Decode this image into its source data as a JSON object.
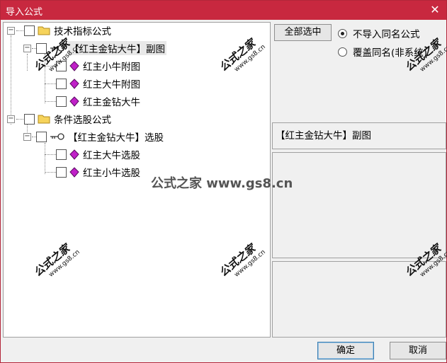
{
  "window": {
    "title": "导入公式"
  },
  "tree": {
    "groups": [
      {
        "label": "技术指标公式",
        "children": [
          {
            "label": "【红主金钻大牛】副图",
            "children": [
              {
                "label": "红主小牛附图"
              },
              {
                "label": "红主大牛附图"
              },
              {
                "label": "红主金钻大牛"
              }
            ]
          }
        ]
      },
      {
        "label": "条件选股公式",
        "children": [
          {
            "label": "【红主金钻大牛】选股",
            "children": [
              {
                "label": "红主大牛选股"
              },
              {
                "label": "红主小牛选股"
              }
            ]
          }
        ]
      }
    ]
  },
  "options": {
    "select_all_label": "全部选中",
    "radio_skip_label": "不导入同名公式",
    "radio_overwrite_label": "覆盖同名(非系统)",
    "selected": "skip"
  },
  "info": {
    "selected_formula": "【红主金钻大牛】副图"
  },
  "buttons": {
    "ok_label": "确定",
    "cancel_label": "取消"
  },
  "watermark": {
    "brand": "公式之家",
    "site": "www.gs8.cn",
    "center": "公式之家 www.gs8.cn"
  }
}
